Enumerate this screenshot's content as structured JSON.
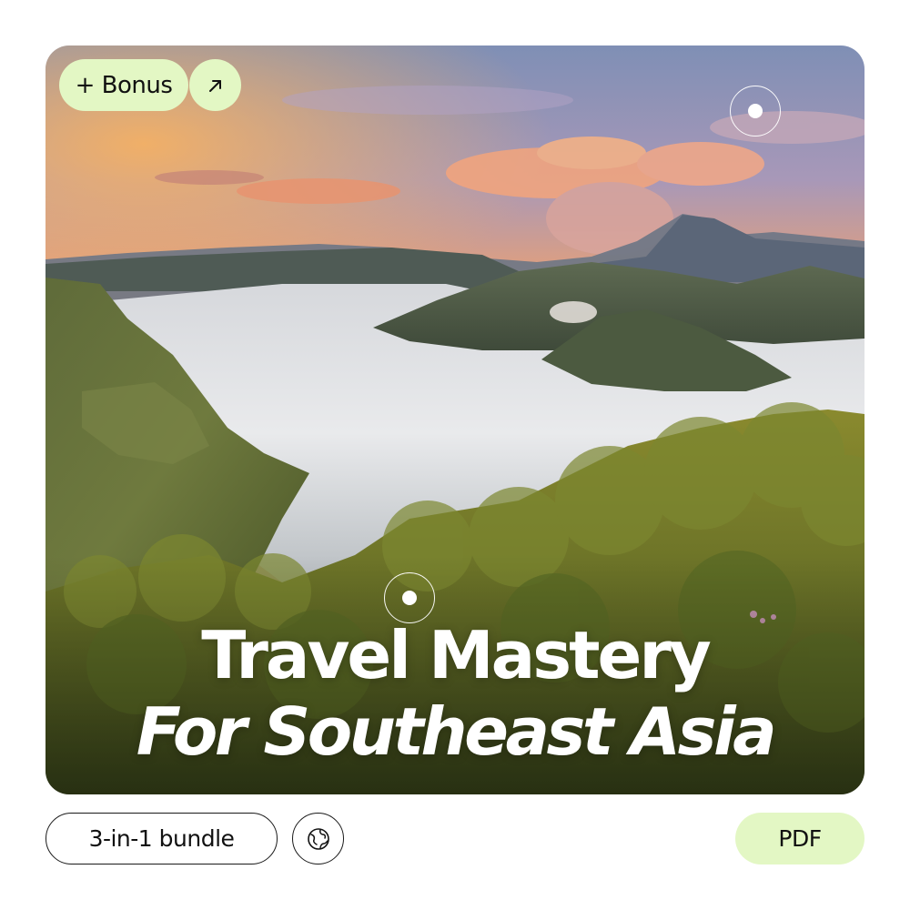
{
  "hero": {
    "image_subject": "volcano-landscape-photo",
    "title_line1": "Travel Mastery",
    "title_line2": "For Southeast Asia"
  },
  "badges": {
    "bonus_label": "+ Bonus",
    "arrow_icon": "arrow-up-right-icon"
  },
  "footer": {
    "bundle_label": "3-in-1 bundle",
    "globe_icon": "globe-icon",
    "format_label": "PDF"
  },
  "colors": {
    "pill_green": "#e3f7c4",
    "outline": "#1a1a1a",
    "title_text": "#ffffff"
  }
}
